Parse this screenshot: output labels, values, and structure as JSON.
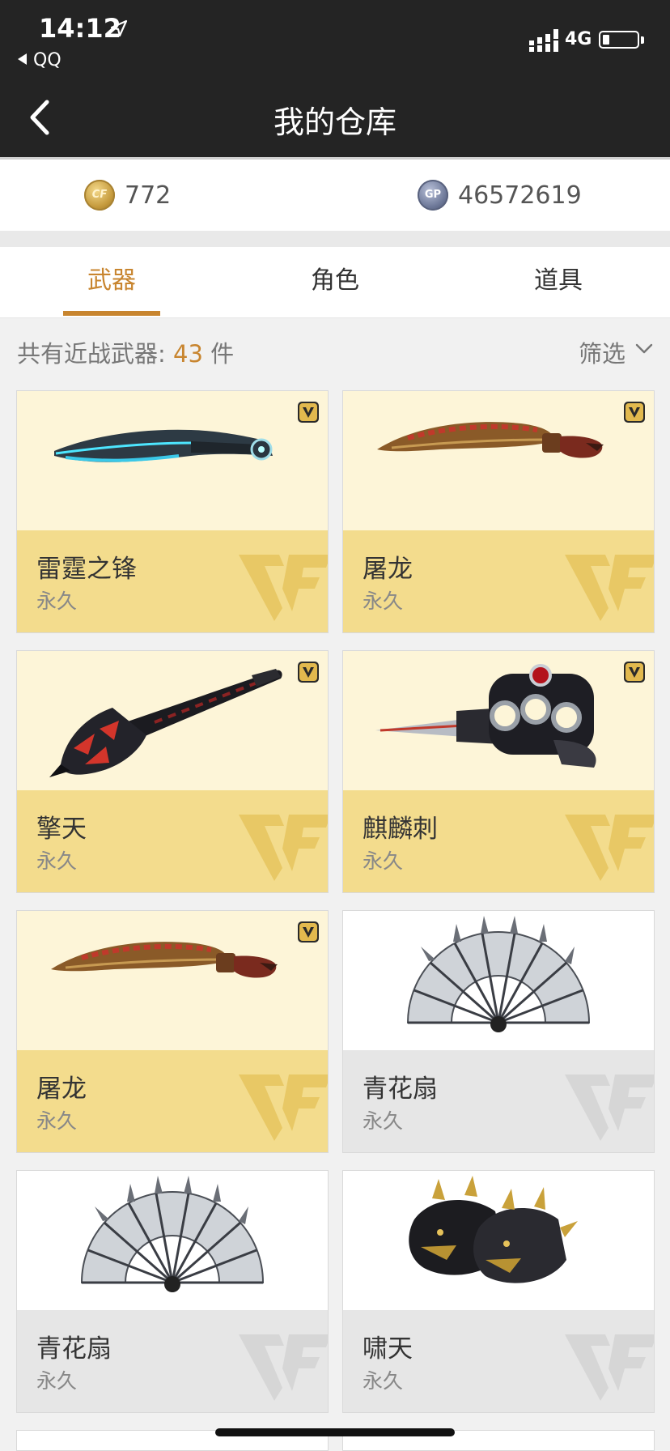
{
  "status": {
    "time": "14:12",
    "back_app": "QQ",
    "network": "4G"
  },
  "nav": {
    "title": "我的仓库"
  },
  "currency": {
    "cf_points": "772",
    "gp_points": "46572619",
    "cf_icon_label": "CF",
    "gp_icon_label": "GP"
  },
  "tabs": [
    {
      "label": "武器"
    },
    {
      "label": "角色"
    },
    {
      "label": "道具"
    }
  ],
  "active_tab": "武器",
  "list_header": {
    "prefix": "共有近战武器: ",
    "count": "43",
    "suffix": " 件",
    "filter_label": "筛选"
  },
  "items": [
    {
      "name": "雷霆之锋",
      "duration": "永久",
      "vip": true,
      "image": "blue-curved-blade"
    },
    {
      "name": "屠龙",
      "duration": "永久",
      "vip": true,
      "image": "dragon-kukri"
    },
    {
      "name": "擎天",
      "duration": "永久",
      "vip": true,
      "image": "dark-shovel"
    },
    {
      "name": "麒麟刺",
      "duration": "永久",
      "vip": true,
      "image": "knuckle-dagger"
    },
    {
      "name": "屠龙",
      "duration": "永久",
      "vip": true,
      "image": "dragon-kukri"
    },
    {
      "name": "青花扇",
      "duration": "永久",
      "vip": false,
      "image": "folding-fan"
    },
    {
      "name": "青花扇",
      "duration": "永久",
      "vip": false,
      "image": "folding-fan"
    },
    {
      "name": "啸天",
      "duration": "永久",
      "vip": false,
      "image": "wolf-head-claws"
    }
  ],
  "colors": {
    "accent": "#c8852f",
    "gold_card_top": "#fdf5d8",
    "gold_card_bottom": "#f3dc8d",
    "plain_card_bottom": "#e6e6e6",
    "nav_bg": "#242424"
  }
}
